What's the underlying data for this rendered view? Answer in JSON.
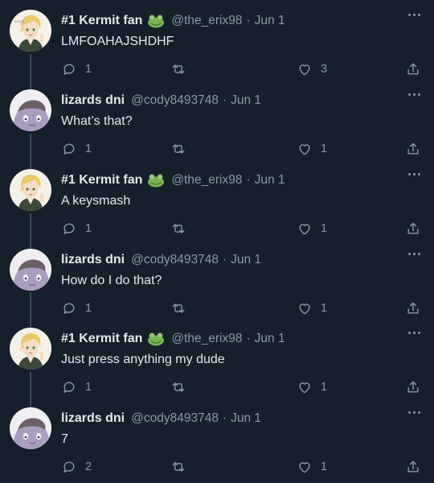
{
  "theme": {
    "background": "#15202b",
    "text": "#e7e9ea",
    "muted": "#8b98a5",
    "line": "#3c4a58"
  },
  "tweets": [
    {
      "name": "#1 Kermit fan",
      "has_frog": true,
      "handle": "@the_erix98",
      "sep": "·",
      "date": "Jun 1",
      "text": "LMFOAHAJSHDHF",
      "replies": "1",
      "retweets": "",
      "likes": "3",
      "avatar": "anime-boy-avatar"
    },
    {
      "name": "lizards dni",
      "has_frog": false,
      "handle": "@cody8493748",
      "sep": "·",
      "date": "Jun 1",
      "text": "What’s that?",
      "replies": "1",
      "retweets": "",
      "likes": "1",
      "avatar": "lizard-avatar"
    },
    {
      "name": "#1 Kermit fan",
      "has_frog": true,
      "handle": "@the_erix98",
      "sep": "·",
      "date": "Jun 1",
      "text": "A keysmash",
      "replies": "1",
      "retweets": "",
      "likes": "1",
      "avatar": "anime-boy-avatar"
    },
    {
      "name": "lizards dni",
      "has_frog": false,
      "handle": "@cody8493748",
      "sep": "·",
      "date": "Jun 1",
      "text": "How do I do that?",
      "replies": "1",
      "retweets": "",
      "likes": "1",
      "avatar": "lizard-avatar"
    },
    {
      "name": "#1 Kermit fan",
      "has_frog": true,
      "handle": "@the_erix98",
      "sep": "·",
      "date": "Jun 1",
      "text": "Just press anything my dude",
      "replies": "1",
      "retweets": "",
      "likes": "1",
      "avatar": "anime-boy-avatar"
    },
    {
      "name": "lizards dni",
      "has_frog": false,
      "handle": "@cody8493748",
      "sep": "·",
      "date": "Jun 1",
      "text": "7",
      "replies": "2",
      "retweets": "",
      "likes": "1",
      "avatar": "lizard-avatar"
    }
  ],
  "icons": {
    "reply": "reply-icon",
    "retweet": "retweet-icon",
    "like": "heart-icon",
    "share": "share-icon",
    "more": "more-icon",
    "frog": "frog-emoji-icon"
  }
}
